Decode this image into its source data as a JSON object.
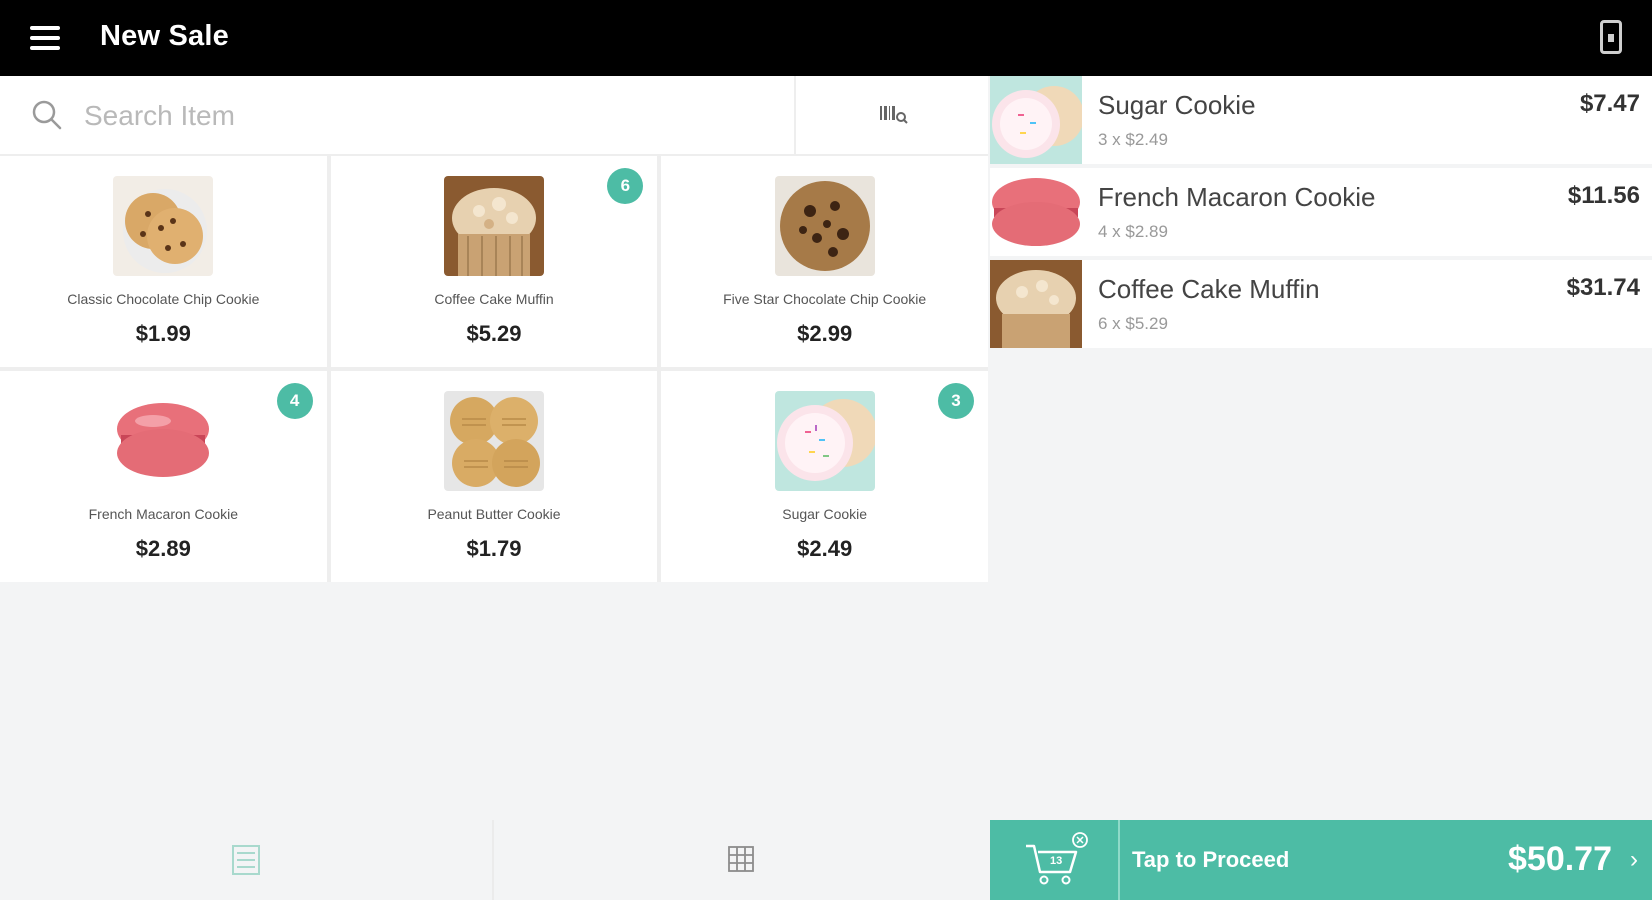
{
  "topbar": {
    "title": "New Sale"
  },
  "search": {
    "placeholder": "Search Item"
  },
  "products": [
    {
      "name": "Classic Chocolate Chip Cookie",
      "price": "$1.99",
      "badge": "",
      "image": "chocolate-chip-cookie"
    },
    {
      "name": "Coffee Cake Muffin",
      "price": "$5.29",
      "badge": "6",
      "image": "coffee-cake-muffin"
    },
    {
      "name": "Five Star Chocolate Chip Cookie",
      "price": "$2.99",
      "badge": "",
      "image": "five-star-cookie"
    },
    {
      "name": "French Macaron Cookie",
      "price": "$2.89",
      "badge": "4",
      "image": "french-macaron"
    },
    {
      "name": "Peanut Butter Cookie",
      "price": "$1.79",
      "badge": "",
      "image": "peanut-butter-cookie"
    },
    {
      "name": "Sugar Cookie",
      "price": "$2.49",
      "badge": "3",
      "image": "sugar-cookie"
    }
  ],
  "cart": {
    "items": [
      {
        "name": "Sugar Cookie",
        "qty": "3 x $2.49",
        "total": "$7.47",
        "image": "sugar-cookie"
      },
      {
        "name": "French Macaron Cookie",
        "qty": "4 x $2.89",
        "total": "$11.56",
        "image": "french-macaron"
      },
      {
        "name": "Coffee Cake Muffin",
        "qty": "6 x $5.29",
        "total": "$31.74",
        "image": "coffee-cake-muffin"
      }
    ],
    "count": "13",
    "proceed_label": "Tap to Proceed",
    "grand_total": "$50.77"
  },
  "colors": {
    "accent": "#4dbca5",
    "topbar": "#000000",
    "background": "#f3f4f5"
  },
  "icons": [
    "menu-icon",
    "device-icon",
    "search-icon",
    "barcode-icon",
    "list-view-icon",
    "grid-view-icon",
    "cart-icon",
    "chevron-right-icon"
  ]
}
